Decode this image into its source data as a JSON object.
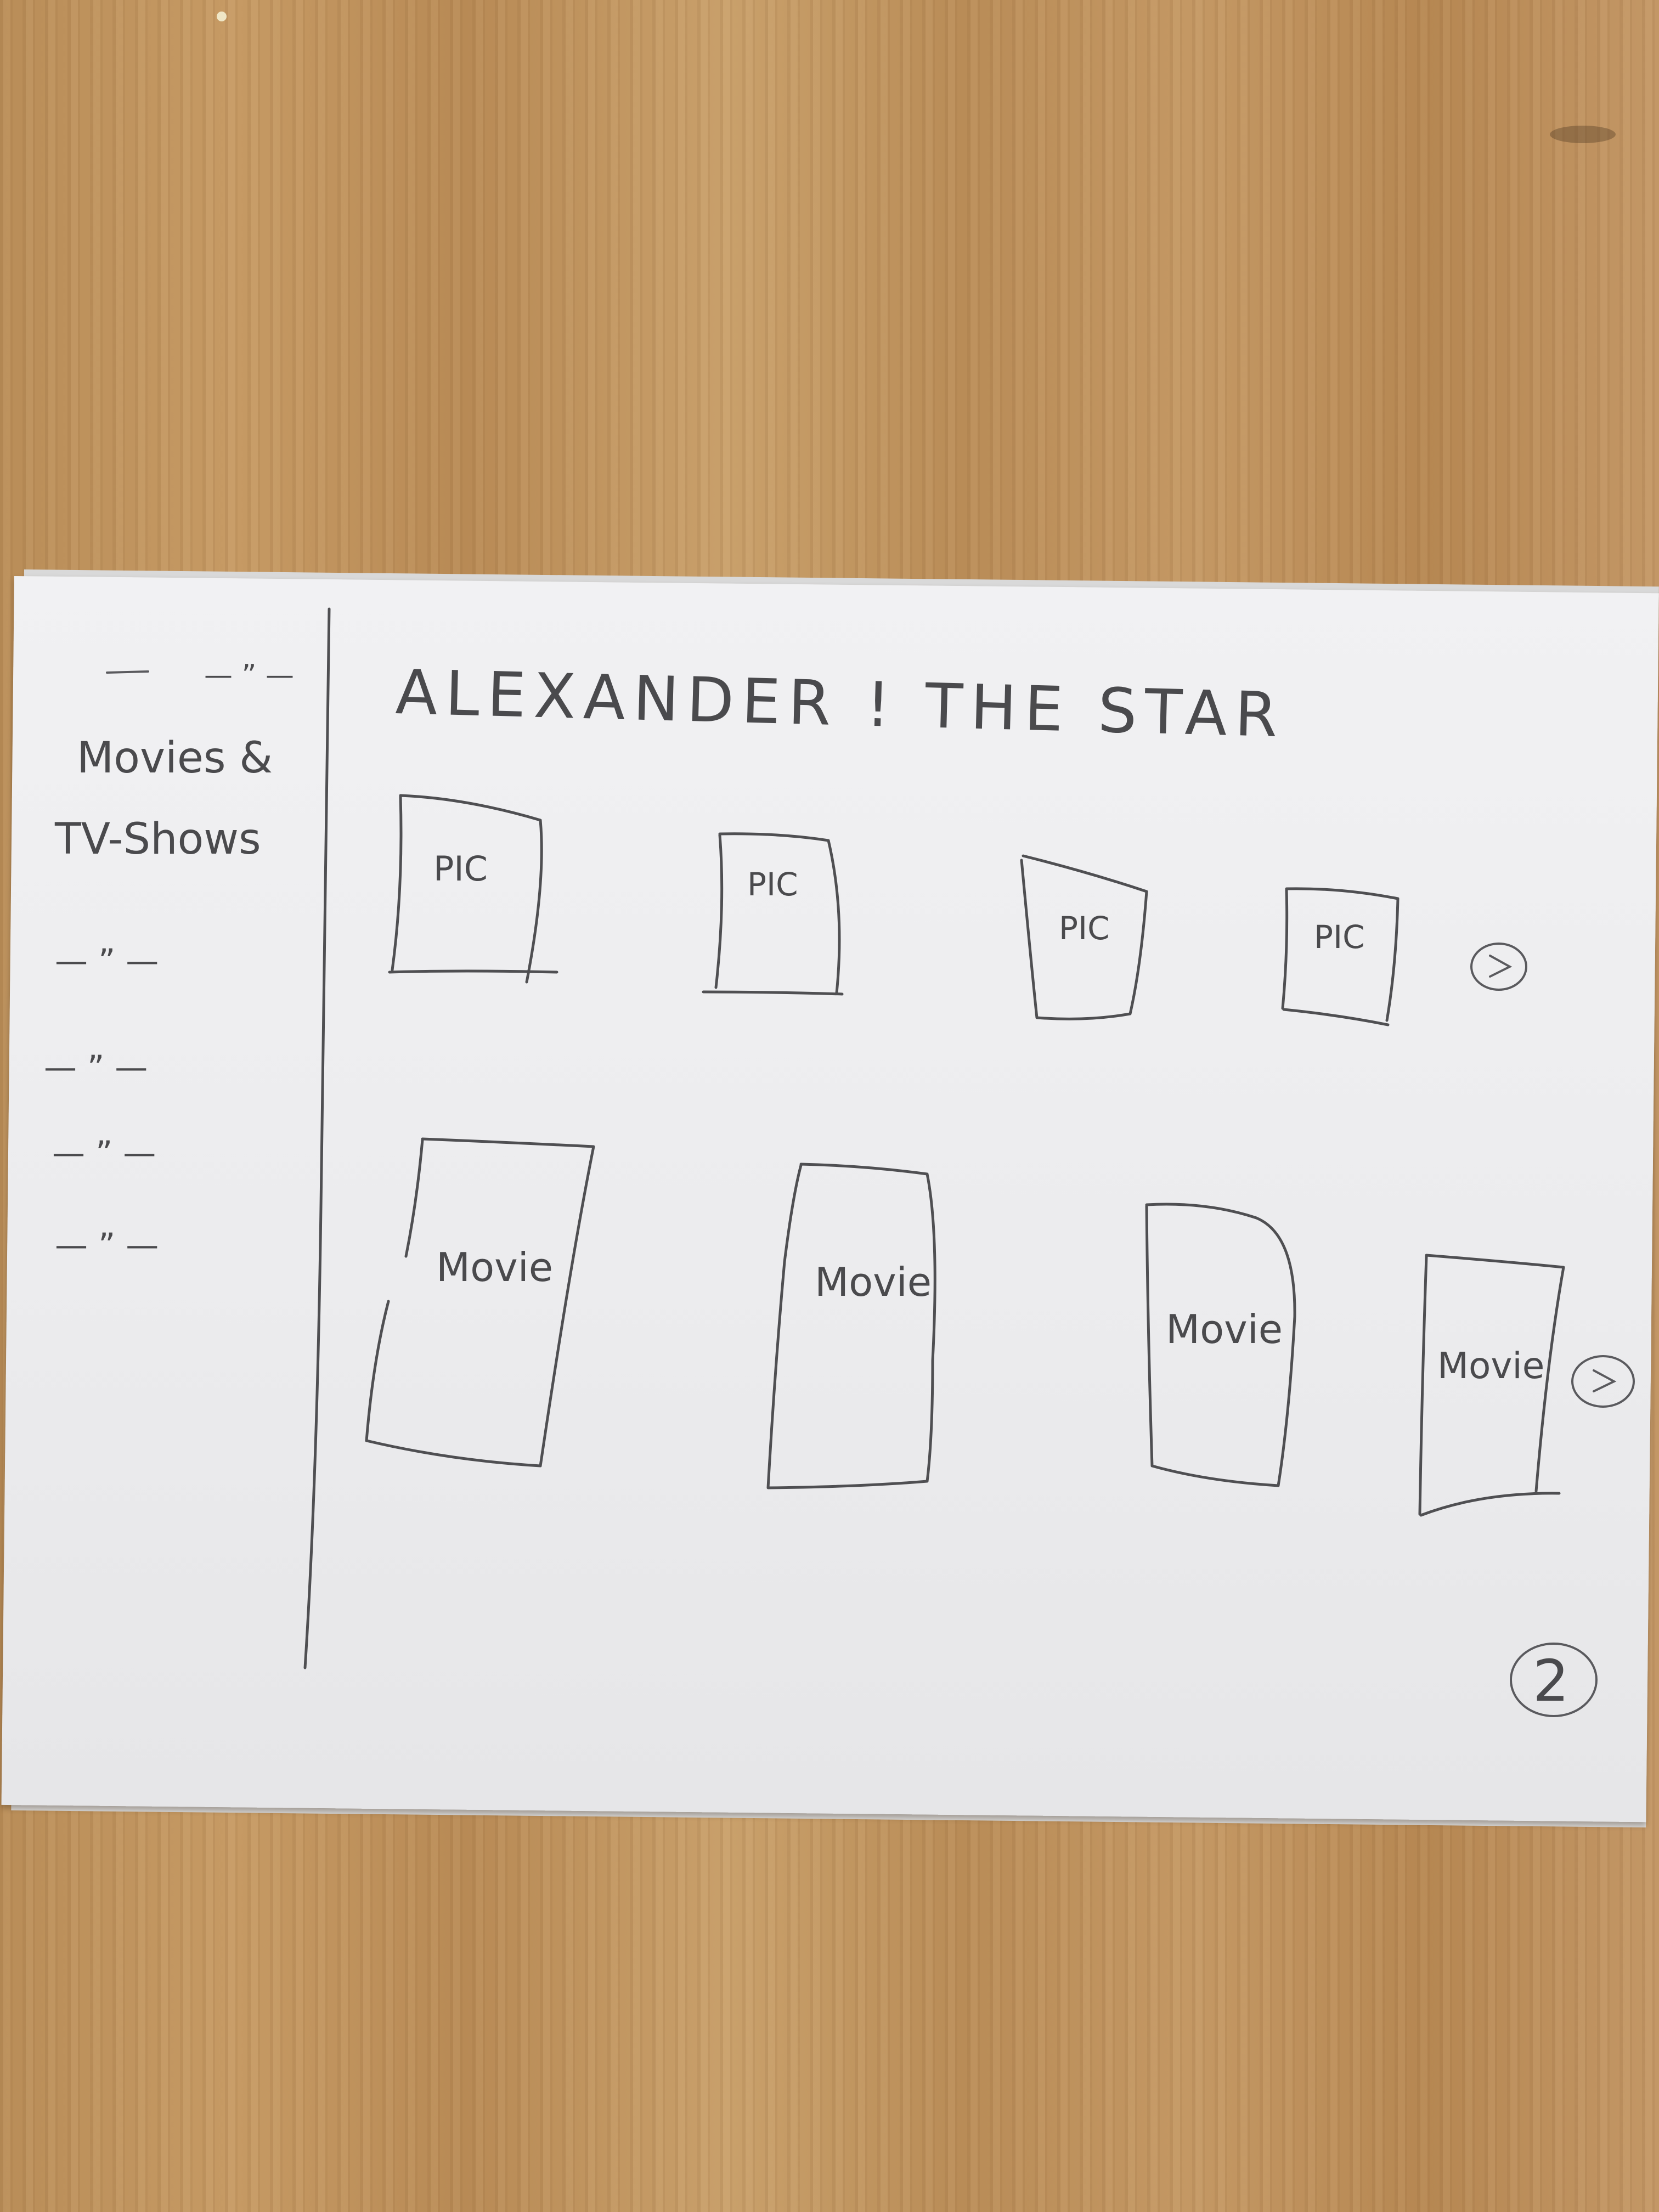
{
  "header": {
    "title": "ALEXANDER ! THE STAR"
  },
  "sidebar": {
    "heading": "Movies & TV-Shows",
    "items": [
      "—  ” —",
      "—  ” —",
      "—  ” —",
      "—  ” —",
      "—  ” —"
    ]
  },
  "rows": [
    {
      "name": "pictures",
      "cards": [
        "PIC",
        "PIC",
        "PIC",
        "PIC"
      ],
      "next_icon": "chevron-right-icon"
    },
    {
      "name": "movies",
      "cards": [
        "Movie",
        "Movie",
        "Movie",
        "Movie"
      ],
      "next_icon": "chevron-right-icon"
    }
  ],
  "page_number": "2"
}
